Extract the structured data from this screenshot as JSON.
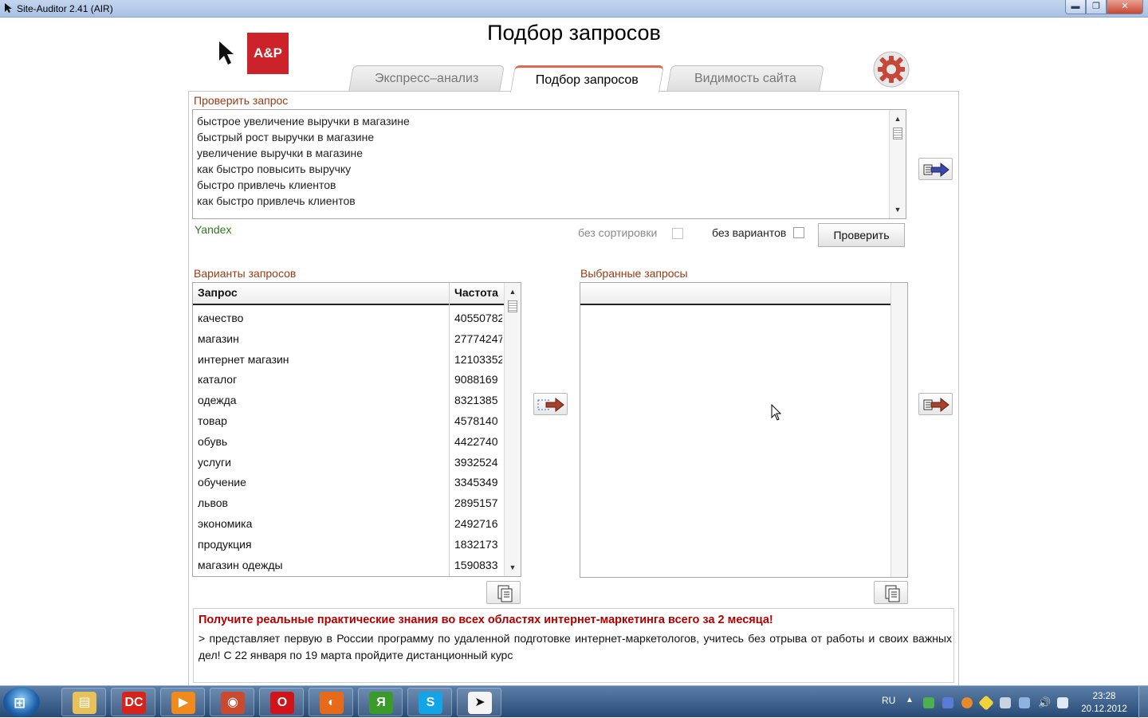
{
  "window": {
    "title": "Site-Auditor 2.41 (AIR)",
    "minimize": "▬",
    "maximize": "❐",
    "close": "✕"
  },
  "header": {
    "logo_text": "A&P",
    "page_title": "Подбор запросов"
  },
  "tabs": [
    {
      "label": "Экспресс–анализ",
      "active": false
    },
    {
      "label": "Подбор запросов",
      "active": true
    },
    {
      "label": "Видимость сайта",
      "active": false
    }
  ],
  "check_query": {
    "label": "Проверить запрос",
    "lines": [
      "быстрое увеличение выручки в магазине",
      "быстрый рост выручки в магазине",
      "увеличение выручки в магазине",
      "как быстро повысить выручку",
      "быстро привлечь клиентов",
      "как быстро привлечь клиентов"
    ],
    "engine": "Yandex",
    "no_sort_label": "без сортировки",
    "no_variants_label": "без вариантов",
    "check_button": "Проверить"
  },
  "variants": {
    "label": "Варианты запросов",
    "columns": [
      "Запрос",
      "Частота"
    ],
    "rows": [
      {
        "query": "качество",
        "freq": "40550782"
      },
      {
        "query": "магазин",
        "freq": "27774247"
      },
      {
        "query": "интернет магазин",
        "freq": "12103352"
      },
      {
        "query": "каталог",
        "freq": "9088169"
      },
      {
        "query": "одежда",
        "freq": "8321385"
      },
      {
        "query": "товар",
        "freq": "4578140"
      },
      {
        "query": "обувь",
        "freq": "4422740"
      },
      {
        "query": "услуги",
        "freq": "3932524"
      },
      {
        "query": "обучение",
        "freq": "3345349"
      },
      {
        "query": "львов",
        "freq": "2895157"
      },
      {
        "query": "экономика",
        "freq": "2492716"
      },
      {
        "query": "продукция",
        "freq": "1832173"
      },
      {
        "query": "магазин одежды",
        "freq": "1590833"
      }
    ]
  },
  "selected": {
    "label": "Выбранные запросы"
  },
  "ad": {
    "title": "Получите реальные практические знания во всех областях интернет-маркетинга всего за 2 месяца!",
    "text": "> представляет первую в России программу по удаленной подготовке интернет-маркетологов, учитесь без отрыва от работы и своих важных дел! С 22 января по 19 марта пройдите дистанционный курс"
  },
  "taskbar": {
    "language": "RU",
    "time": "23:28",
    "date": "20.12.2012",
    "apps": [
      {
        "name": "explorer",
        "color": "#e8c15a",
        "glyph": "▤"
      },
      {
        "name": "dc-spark",
        "color": "#d8231b",
        "glyph": "DC"
      },
      {
        "name": "media-player",
        "color": "#f08a1c",
        "glyph": "▶"
      },
      {
        "name": "chrome-like",
        "color": "#c94a2f",
        "glyph": "◉"
      },
      {
        "name": "opera",
        "color": "#d1141a",
        "glyph": "O"
      },
      {
        "name": "firefox",
        "color": "#e76a1a",
        "glyph": "◐"
      },
      {
        "name": "yandex",
        "color": "#3a9a2a",
        "glyph": "Я"
      },
      {
        "name": "skype",
        "color": "#12a4e6",
        "glyph": "S"
      },
      {
        "name": "site-auditor",
        "color": "#f4f4f4",
        "glyph": "➤"
      }
    ]
  }
}
